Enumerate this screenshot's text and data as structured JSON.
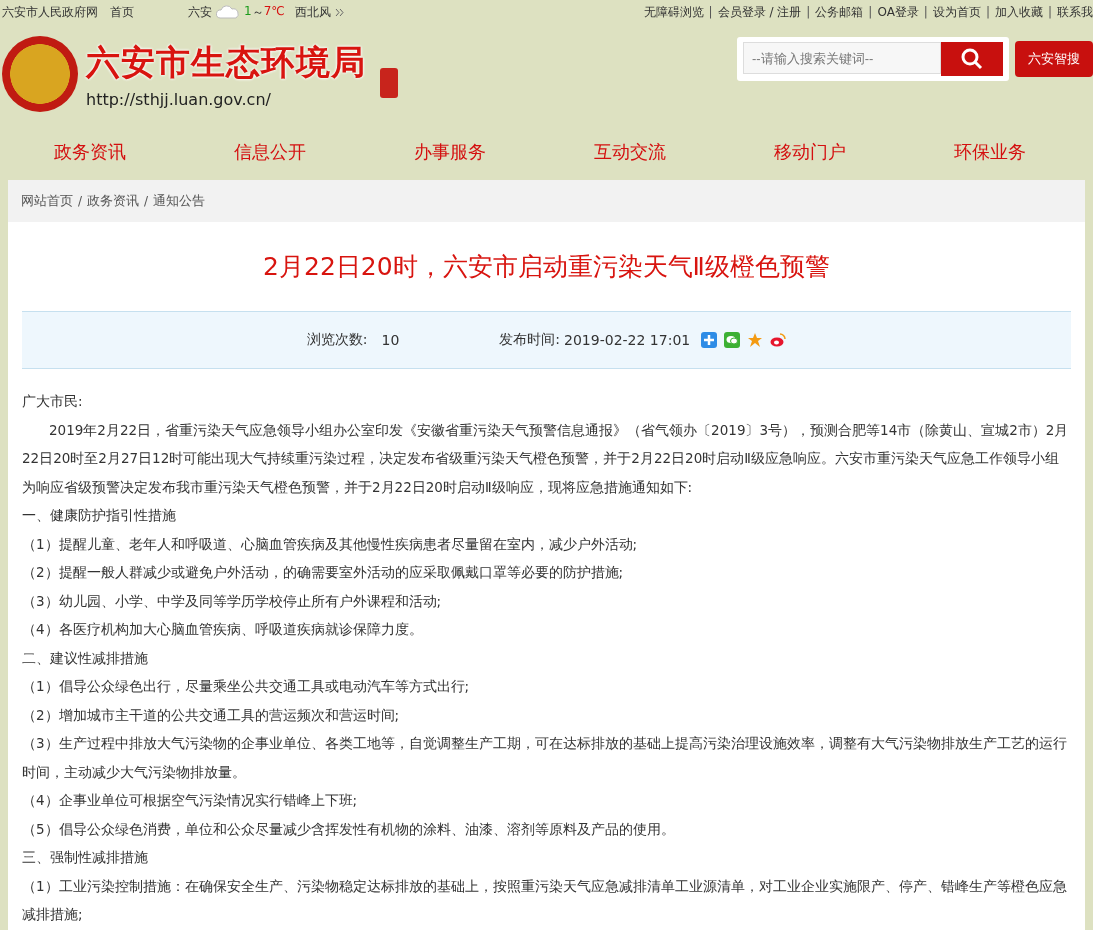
{
  "top_bar": {
    "left_links": [
      "六安市人民政府网",
      "首页"
    ],
    "weather": {
      "city": "六安",
      "low": "1",
      "sep": "～",
      "high": "7℃",
      "wind": "西北风"
    },
    "link_separator": "|",
    "right_links": [
      "无障碍浏览",
      "会员登录 / 注册",
      "公务邮箱",
      "OA登录",
      "设为首页",
      "加入收藏",
      "联系我"
    ]
  },
  "header": {
    "site_title": "六安市生态环境局",
    "url": "http://sthjj.luan.gov.cn/",
    "search": {
      "placeholder": "--请输入搜索关键词--"
    },
    "smart_search_button": "六安智搜"
  },
  "nav": {
    "items": [
      "政务资讯",
      "信息公开",
      "办事服务",
      "互动交流",
      "移动门户",
      "环保业务"
    ]
  },
  "breadcrumb": [
    "网站首页",
    "政务资讯",
    "通知公告"
  ],
  "breadcrumb_separator": "/",
  "article": {
    "title": "2月22日20时，六安市启动重污染天气Ⅱ级橙色预警",
    "views_label": "浏览次数:",
    "views": "10",
    "date_label": "发布时间:",
    "date": "2019-02-22 17:01",
    "paragraphs": [
      {
        "kind": "plain",
        "text": "广大市民:"
      },
      {
        "kind": "indent",
        "text": "2019年2月22日，省重污染天气应急领导小组办公室印发《安徽省重污染天气预警信息通报》（省气领办〔2019〕3号），预测合肥等14市（除黄山、宣城2市）2月22日20时至2月27日12时可能出现大气持续重污染过程，决定发布省级重污染天气橙色预警，并于2月22日20时启动Ⅱ级应急响应。六安市重污染天气应急工作领导小组为响应省级预警决定发布我市重污染天气橙色预警，并于2月22日20时启动Ⅱ级响应，现将应急措施通知如下:"
      },
      {
        "kind": "plain",
        "text": "一、健康防护指引性措施"
      },
      {
        "kind": "item",
        "text": "（1）提醒儿童、老年人和呼吸道、心脑血管疾病及其他慢性疾病患者尽量留在室内，减少户外活动;"
      },
      {
        "kind": "item",
        "text": "（2）提醒一般人群减少或避免户外活动，的确需要室外活动的应采取佩戴口罩等必要的防护措施;"
      },
      {
        "kind": "item",
        "text": "（3）幼儿园、小学、中学及同等学历学校停止所有户外课程和活动;"
      },
      {
        "kind": "item",
        "text": "（4）各医疗机构加大心脑血管疾病、呼吸道疾病就诊保障力度。"
      },
      {
        "kind": "plain",
        "text": "二、建议性减排措施"
      },
      {
        "kind": "item",
        "text": "（1）倡导公众绿色出行，尽量乘坐公共交通工具或电动汽车等方式出行;"
      },
      {
        "kind": "item",
        "text": "（2）增加城市主干道的公共交通工具的营运频次和营运时间;"
      },
      {
        "kind": "item",
        "text": "（3）生产过程中排放大气污染物的企事业单位、各类工地等，自觉调整生产工期，可在达标排放的基础上提高污染治理设施效率，调整有大气污染物排放生产工艺的运行时间，主动减少大气污染物排放量。"
      },
      {
        "kind": "item",
        "text": "（4）企事业单位可根据空气污染情况实行错峰上下班;"
      },
      {
        "kind": "item",
        "text": "（5）倡导公众绿色消费，单位和公众尽量减少含挥发性有机物的涂料、油漆、溶剂等原料及产品的使用。"
      },
      {
        "kind": "plain",
        "text": "三、强制性减排措施"
      },
      {
        "kind": "item",
        "text": "（1）工业污染控制措施：在确保安全生产、污染物稳定达标排放的基础上，按照重污染天气应急减排清单工业源清单，对工业企业实施限产、停产、错峰生产等橙色应急减排措施;"
      }
    ]
  }
}
